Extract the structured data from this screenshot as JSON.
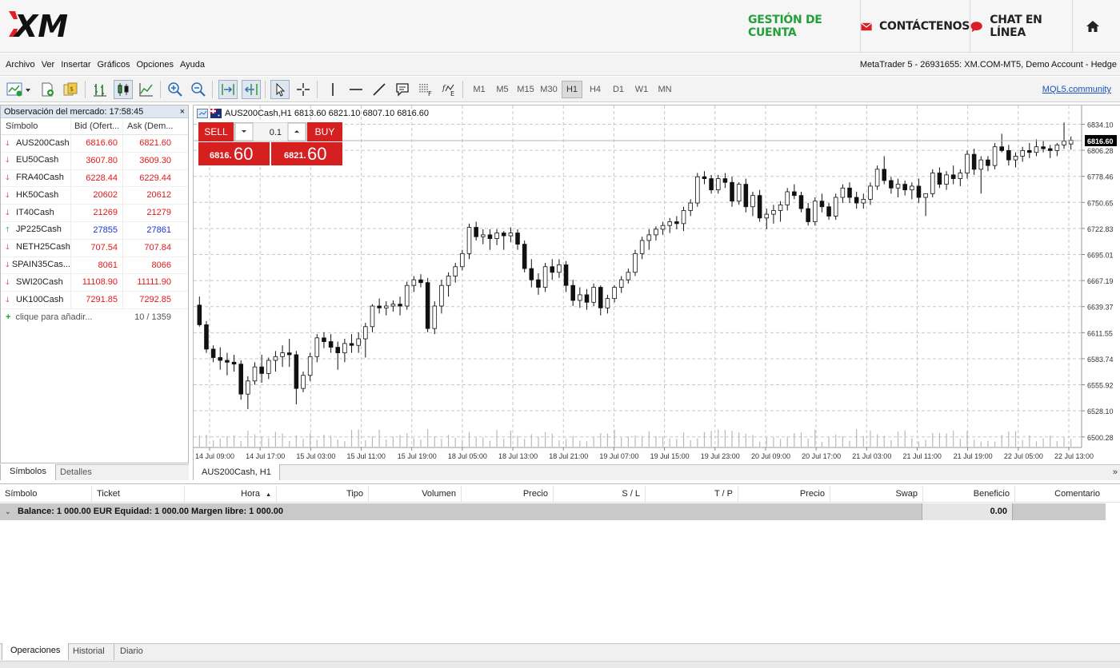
{
  "header": {
    "logo_text": "XM",
    "nav": {
      "account": "GESTIÓN DE CUENTA",
      "contact": "CONTÁCTENOS",
      "chat": "CHAT EN LÍNEA"
    },
    "colors": {
      "account": "#23a03a",
      "logo_red": "#e21f26",
      "icon_red": "#d91f26"
    }
  },
  "menubar": {
    "items": [
      "Archivo",
      "Ver",
      "Insertar",
      "Gráficos",
      "Opciones",
      "Ayuda"
    ],
    "account_info": "MetaTrader 5 - 26931655: XM.COM-MT5, Demo Account - Hedge"
  },
  "toolbar": {
    "icons": [
      "new-chart-icon",
      "add-chart-icon",
      "profiles-icon",
      "bar-chart-icon",
      "candlestick-icon",
      "line-chart-icon",
      "zoom-in-icon",
      "zoom-out-icon",
      "chart-shift-icon",
      "autoscroll-icon",
      "cursor-icon",
      "crosshair-icon",
      "vertical-line-icon",
      "horizontal-line-icon",
      "trend-line-icon",
      "text-icon",
      "fibonacci-icon",
      "indicators-icon"
    ],
    "timeframes": [
      "M1",
      "M5",
      "M15",
      "M30",
      "H1",
      "H4",
      "D1",
      "W1",
      "MN"
    ],
    "active_timeframe": "H1",
    "link": "MQL5.community"
  },
  "market_watch": {
    "title": "Observación del mercado: 17:58:45",
    "close": "×",
    "columns": {
      "symbol": "Símbolo",
      "bid": "Bid (Ofert...",
      "ask": "Ask (Dem..."
    },
    "rows": [
      {
        "symbol": "AUS200Cash",
        "bid": "6816.60",
        "ask": "6821.60",
        "dir": "down"
      },
      {
        "symbol": "EU50Cash",
        "bid": "3607.80",
        "ask": "3609.30",
        "dir": "down"
      },
      {
        "symbol": "FRA40Cash",
        "bid": "6228.44",
        "ask": "6229.44",
        "dir": "down"
      },
      {
        "symbol": "HK50Cash",
        "bid": "20602",
        "ask": "20612",
        "dir": "down"
      },
      {
        "symbol": "IT40Cash",
        "bid": "21269",
        "ask": "21279",
        "dir": "down"
      },
      {
        "symbol": "JP225Cash",
        "bid": "27855",
        "ask": "27861",
        "dir": "up"
      },
      {
        "symbol": "NETH25Cash",
        "bid": "707.54",
        "ask": "707.84",
        "dir": "down"
      },
      {
        "symbol": "SPAIN35Cas...",
        "bid": "8061",
        "ask": "8066",
        "dir": "down"
      },
      {
        "symbol": "SWI20Cash",
        "bid": "11108.90",
        "ask": "11111.90",
        "dir": "down"
      },
      {
        "symbol": "UK100Cash",
        "bid": "7291.85",
        "ask": "7292.85",
        "dir": "down"
      }
    ],
    "add_label": "clique para añadir...",
    "count": "10 / 1359",
    "tabs": [
      "Símbolos",
      "Detalles"
    ]
  },
  "chart": {
    "info": "AUS200Cash,H1  6813.60 6821.10 6807.10 6816.60",
    "tab": "AUS200Cash, H1",
    "trade": {
      "sell_label": "SELL",
      "buy_label": "BUY",
      "volume": "0.1",
      "sell_price_small": "6816.",
      "sell_price_big": "60",
      "buy_price_small": "6821.",
      "buy_price_big": "60"
    },
    "current_price": "6816.60",
    "colors": {
      "trade_red": "#d61f1f",
      "grid": "#c8c8c8",
      "price_label_bg": "#000000"
    }
  },
  "chart_data": {
    "type": "candlestick",
    "symbol": "AUS200Cash",
    "timeframe": "H1",
    "y_ticks": [
      "6834.10",
      "6806.28",
      "6778.46",
      "6750.65",
      "6722.83",
      "6695.01",
      "6667.19",
      "6639.37",
      "6611.55",
      "6583.74",
      "6555.92",
      "6528.10",
      "6500.28"
    ],
    "ylim": [
      6489,
      6849
    ],
    "x_ticks": [
      "14 Jul 09:00",
      "14 Jul 17:00",
      "15 Jul 03:00",
      "15 Jul 11:00",
      "15 Jul 19:00",
      "18 Jul 05:00",
      "18 Jul 13:00",
      "18 Jul 21:00",
      "19 Jul 07:00",
      "19 Jul 15:00",
      "19 Jul 23:00",
      "20 Jul 09:00",
      "20 Jul 17:00",
      "21 Jul 03:00",
      "21 Jul 11:00",
      "21 Jul 19:00",
      "22 Jul 05:00",
      "22 Jul 13:00"
    ],
    "last_price": 6816.6,
    "ohlc": [
      [
        6641,
        6650,
        6618,
        6620
      ],
      [
        6620,
        6624,
        6590,
        6594
      ],
      [
        6594,
        6598,
        6580,
        6585
      ],
      [
        6585,
        6596,
        6572,
        6582
      ],
      [
        6582,
        6590,
        6566,
        6580
      ],
      [
        6580,
        6588,
        6570,
        6578
      ],
      [
        6578,
        6582,
        6540,
        6546
      ],
      [
        6546,
        6565,
        6530,
        6560
      ],
      [
        6560,
        6580,
        6556,
        6575
      ],
      [
        6575,
        6588,
        6558,
        6568
      ],
      [
        6568,
        6585,
        6562,
        6582
      ],
      [
        6582,
        6592,
        6570,
        6586
      ],
      [
        6586,
        6598,
        6575,
        6590
      ],
      [
        6590,
        6605,
        6575,
        6588
      ],
      [
        6588,
        6592,
        6535,
        6552
      ],
      [
        6552,
        6570,
        6548,
        6566
      ],
      [
        6566,
        6590,
        6560,
        6586
      ],
      [
        6586,
        6610,
        6580,
        6606
      ],
      [
        6606,
        6612,
        6595,
        6602
      ],
      [
        6602,
        6610,
        6590,
        6596
      ],
      [
        6596,
        6602,
        6572,
        6590
      ],
      [
        6590,
        6605,
        6580,
        6600
      ],
      [
        6600,
        6610,
        6590,
        6598
      ],
      [
        6598,
        6612,
        6590,
        6605
      ],
      [
        6605,
        6622,
        6585,
        6618
      ],
      [
        6618,
        6642,
        6612,
        6640
      ],
      [
        6640,
        6648,
        6632,
        6638
      ],
      [
        6638,
        6645,
        6630,
        6640
      ],
      [
        6640,
        6646,
        6634,
        6642
      ],
      [
        6642,
        6650,
        6630,
        6640
      ],
      [
        6640,
        6666,
        6636,
        6662
      ],
      [
        6662,
        6672,
        6655,
        6668
      ],
      [
        6668,
        6674,
        6660,
        6665
      ],
      [
        6665,
        6670,
        6612,
        6616
      ],
      [
        6616,
        6645,
        6610,
        6640
      ],
      [
        6640,
        6668,
        6632,
        6662
      ],
      [
        6662,
        6676,
        6650,
        6672
      ],
      [
        6672,
        6686,
        6665,
        6682
      ],
      [
        6682,
        6700,
        6678,
        6696
      ],
      [
        6696,
        6728,
        6690,
        6724
      ],
      [
        6724,
        6730,
        6710,
        6714
      ],
      [
        6714,
        6722,
        6706,
        6716
      ],
      [
        6716,
        6722,
        6700,
        6712
      ],
      [
        6712,
        6722,
        6705,
        6718
      ],
      [
        6718,
        6720,
        6700,
        6715
      ],
      [
        6715,
        6724,
        6708,
        6718
      ],
      [
        6718,
        6722,
        6700,
        6706
      ],
      [
        6706,
        6710,
        6676,
        6680
      ],
      [
        6680,
        6690,
        6660,
        6668
      ],
      [
        6668,
        6675,
        6652,
        6660
      ],
      [
        6660,
        6686,
        6655,
        6682
      ],
      [
        6682,
        6690,
        6668,
        6676
      ],
      [
        6676,
        6690,
        6670,
        6684
      ],
      [
        6684,
        6688,
        6655,
        6662
      ],
      [
        6662,
        6668,
        6640,
        6646
      ],
      [
        6646,
        6660,
        6638,
        6652
      ],
      [
        6652,
        6658,
        6636,
        6644
      ],
      [
        6644,
        6664,
        6640,
        6660
      ],
      [
        6660,
        6662,
        6630,
        6638
      ],
      [
        6638,
        6652,
        6632,
        6648
      ],
      [
        6648,
        6662,
        6644,
        6660
      ],
      [
        6660,
        6672,
        6654,
        6668
      ],
      [
        6668,
        6680,
        6664,
        6676
      ],
      [
        6676,
        6700,
        6672,
        6696
      ],
      [
        6696,
        6714,
        6690,
        6710
      ],
      [
        6710,
        6722,
        6700,
        6716
      ],
      [
        6716,
        6725,
        6710,
        6722
      ],
      [
        6722,
        6730,
        6716,
        6726
      ],
      [
        6726,
        6734,
        6718,
        6730
      ],
      [
        6730,
        6736,
        6722,
        6728
      ],
      [
        6728,
        6746,
        6720,
        6742
      ],
      [
        6742,
        6754,
        6736,
        6750
      ],
      [
        6750,
        6782,
        6746,
        6778
      ],
      [
        6778,
        6784,
        6770,
        6776
      ],
      [
        6776,
        6780,
        6760,
        6764
      ],
      [
        6764,
        6780,
        6760,
        6776
      ],
      [
        6776,
        6782,
        6766,
        6772
      ],
      [
        6772,
        6778,
        6746,
        6752
      ],
      [
        6752,
        6772,
        6748,
        6770
      ],
      [
        6770,
        6776,
        6740,
        6746
      ],
      [
        6746,
        6762,
        6736,
        6758
      ],
      [
        6758,
        6764,
        6730,
        6734
      ],
      [
        6734,
        6744,
        6722,
        6738
      ],
      [
        6738,
        6748,
        6728,
        6742
      ],
      [
        6742,
        6752,
        6730,
        6748
      ],
      [
        6748,
        6766,
        6742,
        6762
      ],
      [
        6762,
        6770,
        6754,
        6758
      ],
      [
        6758,
        6762,
        6740,
        6744
      ],
      [
        6744,
        6750,
        6726,
        6730
      ],
      [
        6730,
        6756,
        6726,
        6752
      ],
      [
        6752,
        6760,
        6740,
        6746
      ],
      [
        6746,
        6750,
        6732,
        6736
      ],
      [
        6736,
        6760,
        6732,
        6756
      ],
      [
        6756,
        6770,
        6750,
        6766
      ],
      [
        6766,
        6772,
        6750,
        6756
      ],
      [
        6756,
        6762,
        6744,
        6750
      ],
      [
        6750,
        6760,
        6744,
        6754
      ],
      [
        6754,
        6772,
        6748,
        6768
      ],
      [
        6768,
        6790,
        6764,
        6786
      ],
      [
        6786,
        6800,
        6770,
        6774
      ],
      [
        6774,
        6778,
        6760,
        6766
      ],
      [
        6766,
        6776,
        6756,
        6770
      ],
      [
        6770,
        6774,
        6758,
        6764
      ],
      [
        6764,
        6772,
        6754,
        6768
      ],
      [
        6768,
        6776,
        6750,
        6756
      ],
      [
        6756,
        6760,
        6736,
        6760
      ],
      [
        6760,
        6786,
        6756,
        6782
      ],
      [
        6782,
        6788,
        6766,
        6770
      ],
      [
        6770,
        6784,
        6764,
        6780
      ],
      [
        6780,
        6790,
        6770,
        6776
      ],
      [
        6776,
        6786,
        6768,
        6782
      ],
      [
        6782,
        6806,
        6776,
        6802
      ],
      [
        6802,
        6808,
        6780,
        6786
      ],
      [
        6786,
        6800,
        6760,
        6796
      ],
      [
        6796,
        6800,
        6784,
        6790
      ],
      [
        6790,
        6814,
        6786,
        6810
      ],
      [
        6810,
        6824,
        6804,
        6806
      ],
      [
        6806,
        6812,
        6790,
        6796
      ],
      [
        6796,
        6804,
        6788,
        6800
      ],
      [
        6800,
        6810,
        6794,
        6806
      ],
      [
        6806,
        6814,
        6798,
        6804
      ],
      [
        6804,
        6818,
        6800,
        6810
      ],
      [
        6810,
        6816,
        6804,
        6808
      ],
      [
        6808,
        6812,
        6798,
        6806
      ],
      [
        6806,
        6814,
        6800,
        6812
      ],
      [
        6812,
        6836,
        6808,
        6816
      ],
      [
        6813,
        6821,
        6807,
        6817
      ]
    ]
  },
  "terminal": {
    "columns": [
      "Símbolo",
      "Ticket",
      "Hora",
      "Tipo",
      "Volumen",
      "Precio",
      "S / L",
      "T / P",
      "Precio",
      "Swap",
      "Beneficio",
      "Comentario"
    ],
    "balance_text": "Balance: 1 000.00 EUR  Equidad: 1 000.00  Margen libre: 1 000.00",
    "profit": "0.00",
    "tabs": [
      "Operaciones",
      "Historial",
      "Diario"
    ]
  }
}
